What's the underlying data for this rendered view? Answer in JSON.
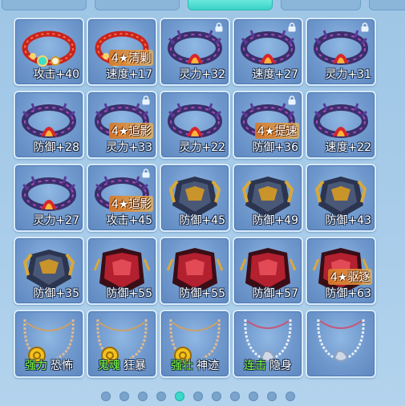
{
  "items": [
    {
      "art": "bracelet-red",
      "stat": "攻击+40",
      "locked": false,
      "badge": ""
    },
    {
      "art": "bracelet-red",
      "stat": "速度+17",
      "locked": false,
      "badge": "4★清剿"
    },
    {
      "art": "bracelet-thorn",
      "stat": "灵力+32",
      "locked": true,
      "badge": ""
    },
    {
      "art": "bracelet-thorn",
      "stat": "速度+27",
      "locked": true,
      "badge": ""
    },
    {
      "art": "bracelet-thorn",
      "stat": "灵力+31",
      "locked": true,
      "badge": ""
    },
    {
      "art": "bracelet-thorn",
      "stat": "防御+28",
      "locked": false,
      "badge": ""
    },
    {
      "art": "bracelet-thorn",
      "stat": "灵力+33",
      "locked": true,
      "badge": "4★追影"
    },
    {
      "art": "bracelet-thorn",
      "stat": "灵力+22",
      "locked": false,
      "badge": ""
    },
    {
      "art": "bracelet-thorn",
      "stat": "防御+36",
      "locked": true,
      "badge": "4★提速"
    },
    {
      "art": "bracelet-thorn",
      "stat": "速度+22",
      "locked": false,
      "badge": ""
    },
    {
      "art": "bracelet-thorn",
      "stat": "灵力+27",
      "locked": false,
      "badge": ""
    },
    {
      "art": "bracelet-thorn",
      "stat": "攻击+45",
      "locked": true,
      "badge": "4★追影"
    },
    {
      "art": "armor-gold",
      "stat": "防御+45",
      "locked": false,
      "badge": ""
    },
    {
      "art": "armor-gold",
      "stat": "防御+49",
      "locked": false,
      "badge": ""
    },
    {
      "art": "armor-gold",
      "stat": "防御+43",
      "locked": false,
      "badge": ""
    },
    {
      "art": "armor-gold",
      "stat": "防御+35",
      "locked": false,
      "badge": ""
    },
    {
      "art": "armor-red",
      "stat": "防御+55",
      "locked": false,
      "badge": ""
    },
    {
      "art": "armor-red",
      "stat": "防御+55",
      "locked": false,
      "badge": ""
    },
    {
      "art": "armor-red",
      "stat": "防御+57",
      "locked": false,
      "badge": ""
    },
    {
      "art": "armor-red",
      "stat": "防御+63",
      "locked": false,
      "badge": "4★驱逐"
    },
    {
      "art": "necklace-coin",
      "tag1": "强力",
      "tag2": "恐怖",
      "locked": false,
      "badge": ""
    },
    {
      "art": "necklace-coin",
      "tag1": "鬼魂",
      "tag2": "狂暴",
      "locked": false,
      "badge": ""
    },
    {
      "art": "necklace-coin",
      "tag1": "强壮",
      "tag2": "神迹",
      "locked": false,
      "badge": ""
    },
    {
      "art": "necklace-silver",
      "tag1": "连击",
      "tag2": "隐身",
      "locked": false,
      "badge": ""
    },
    {
      "art": "necklace-silver",
      "tag1": "",
      "tag2": "",
      "locked": false,
      "badge": ""
    }
  ],
  "pager": {
    "count": 11,
    "active_index": 4
  },
  "colors": {
    "accent": "#3ad9c9",
    "tag_green": "#7cff3a",
    "panel_bg": "#a9cdea"
  }
}
